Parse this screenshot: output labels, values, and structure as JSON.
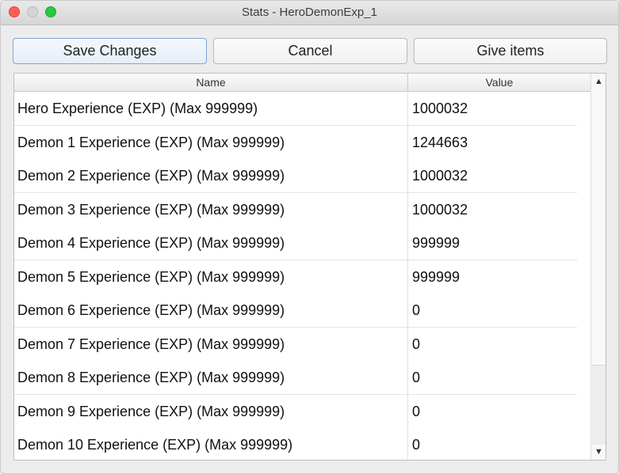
{
  "window": {
    "title": "Stats - HeroDemonExp_1"
  },
  "toolbar": {
    "save_label": "Save Changes",
    "cancel_label": "Cancel",
    "give_items_label": "Give items"
  },
  "table": {
    "headers": {
      "name": "Name",
      "value": "Value"
    },
    "rows": [
      {
        "name": "Hero Experience (EXP) (Max 999999)",
        "value": "1000032"
      },
      {
        "name": "Demon 1 Experience (EXP) (Max 999999)",
        "value": "1244663"
      },
      {
        "name": "Demon 2 Experience (EXP) (Max 999999)",
        "value": "1000032"
      },
      {
        "name": "Demon 3 Experience (EXP) (Max 999999)",
        "value": "1000032"
      },
      {
        "name": "Demon 4 Experience (EXP) (Max 999999)",
        "value": "999999"
      },
      {
        "name": "Demon 5 Experience (EXP) (Max 999999)",
        "value": "999999"
      },
      {
        "name": "Demon 6 Experience (EXP) (Max 999999)",
        "value": "0"
      },
      {
        "name": "Demon 7 Experience (EXP) (Max 999999)",
        "value": "0"
      },
      {
        "name": "Demon 8 Experience (EXP) (Max 999999)",
        "value": "0"
      },
      {
        "name": "Demon 9 Experience (EXP) (Max 999999)",
        "value": "0"
      },
      {
        "name": "Demon 10 Experience (EXP) (Max 999999)",
        "value": "0"
      }
    ]
  },
  "scrollbar": {
    "up_icon": "chevron-up-icon",
    "down_icon": "chevron-down-icon"
  }
}
